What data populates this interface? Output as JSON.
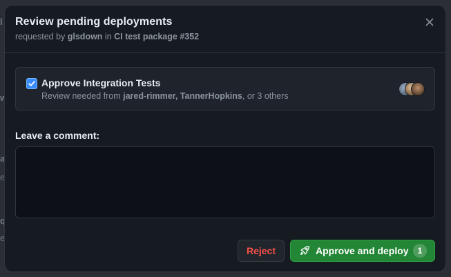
{
  "dialog": {
    "title": "Review pending deployments",
    "subtitle": {
      "prefix": "requested by ",
      "user": "glsdown",
      "mid": " in ",
      "run": "CI test package #352"
    },
    "close_icon": "close-icon"
  },
  "environment": {
    "checked": true,
    "name": "Approve Integration Tests",
    "review": {
      "prefix": "Review needed from ",
      "reviewers": "jared-rimmer, TannerHopkins",
      "suffix": ", or 3 others"
    },
    "avatars": [
      "avatar-1",
      "avatar-2",
      "avatar-3"
    ]
  },
  "comment": {
    "label": "Leave a comment:",
    "value": ""
  },
  "actions": {
    "reject_label": "Reject",
    "approve_label": "Approve and deploy",
    "approve_count": "1",
    "approve_icon": "rocket-icon"
  },
  "background_fragments": [
    "l",
    "w",
    "a",
    "e",
    "e",
    "q",
    "e"
  ],
  "colors": {
    "dialog_bg": "#161b22",
    "card_bg": "#1f242c",
    "input_bg": "#0d1117",
    "border": "#30363d",
    "text": "#e6edf3",
    "muted": "#8b949e",
    "accent_blue": "#388bfd",
    "danger": "#f85149",
    "success": "#238636"
  }
}
